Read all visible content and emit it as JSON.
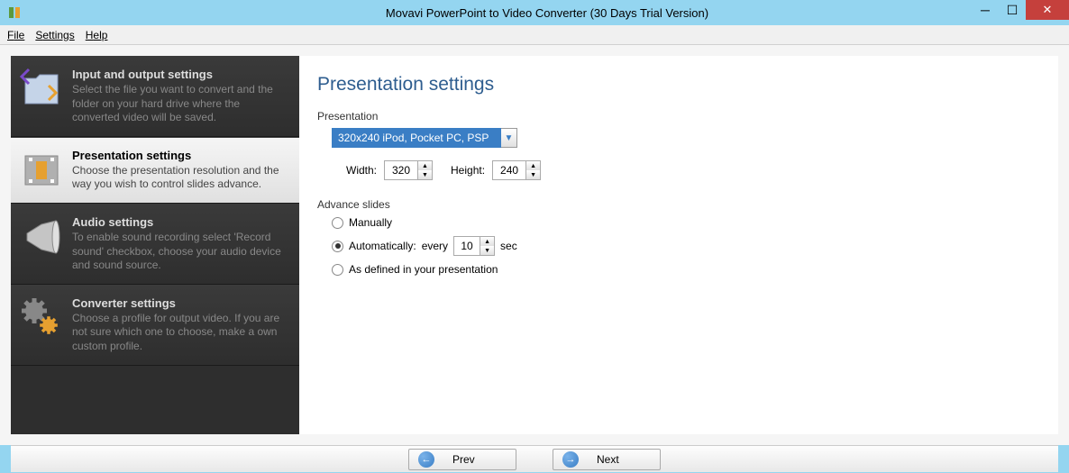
{
  "titlebar": {
    "text": "Movavi PowerPoint to Video Converter (30 Days Trial Version)"
  },
  "menu": {
    "file": "File",
    "settings": "Settings",
    "help": "Help"
  },
  "sidebar": {
    "items": [
      {
        "title": "Input and output settings",
        "desc": "Select the file you want to convert and the folder on your hard drive where the converted video will be saved."
      },
      {
        "title": "Presentation settings",
        "desc": "Choose the presentation resolution and the way you wish to control slides advance."
      },
      {
        "title": "Audio settings",
        "desc": "To enable sound recording select 'Record sound' checkbox, choose your audio device and sound source."
      },
      {
        "title": "Converter settings",
        "desc": "Choose a profile for output video. If you are not sure which one to choose, make a own custom profile."
      }
    ]
  },
  "content": {
    "heading": "Presentation settings",
    "presentation_label": "Presentation",
    "preset_value": "320x240 iPod, Pocket PC, PSP",
    "width_label": "Width:",
    "width_value": "320",
    "height_label": "Height:",
    "height_value": "240",
    "advance_label": "Advance slides",
    "radio_manually": "Manually",
    "radio_auto": "Automatically:",
    "auto_every": "every",
    "auto_seconds": "10",
    "auto_sec": "sec",
    "radio_defined": "As defined in your presentation"
  },
  "footer": {
    "prev": "Prev",
    "next": "Next"
  }
}
